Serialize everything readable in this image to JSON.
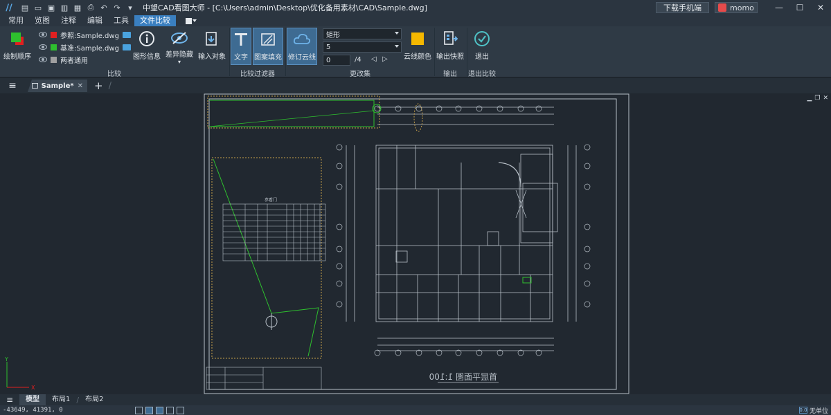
{
  "titlebar": {
    "title": "中望CAD看图大师 - [C:\\Users\\admin\\Desktop\\优化备用素材\\CAD\\Sample.dwg]",
    "download_label": "下载手机端",
    "user_name": "momo"
  },
  "menu": {
    "tabs": [
      "常用",
      "览图",
      "注释",
      "编辑",
      "工具",
      "文件比较"
    ]
  },
  "ribbon": {
    "draw_order": "绘制顺序",
    "ref_file": "参照:Sample.dwg",
    "base_file": "基准:Sample.dwg",
    "both_common": "两者通用",
    "shape_info": "图形信息",
    "diff_hide": "差异隐藏",
    "input_obj": "输入对象",
    "group_compare": "比较",
    "text": "文字",
    "hatch": "图案填充",
    "group_filter": "比较过滤器",
    "revcloud": "修订云线",
    "shape_value": "矩形",
    "size_value": "5",
    "index_value": "0",
    "index_total": "/4",
    "cloud_color": "云线颜色",
    "group_changes": "更改集",
    "export_snapshot": "输出快照",
    "group_output": "输出",
    "exit": "退出",
    "group_exit": "退出比较",
    "colors": {
      "ref": "#e02020",
      "base": "#2ec02e",
      "common": "#a0a0a0",
      "cloud": "#f5b800"
    }
  },
  "doc": {
    "tab_name": "Sample*"
  },
  "drawing": {
    "table_title": "参看门",
    "plan_title": "首层平面图 1:100"
  },
  "layouts": [
    "模型",
    "布局1",
    "布局2"
  ],
  "status": {
    "coords": "-43649, 41391, 0",
    "unit": "无单位",
    "unit_badge": "0.0"
  }
}
